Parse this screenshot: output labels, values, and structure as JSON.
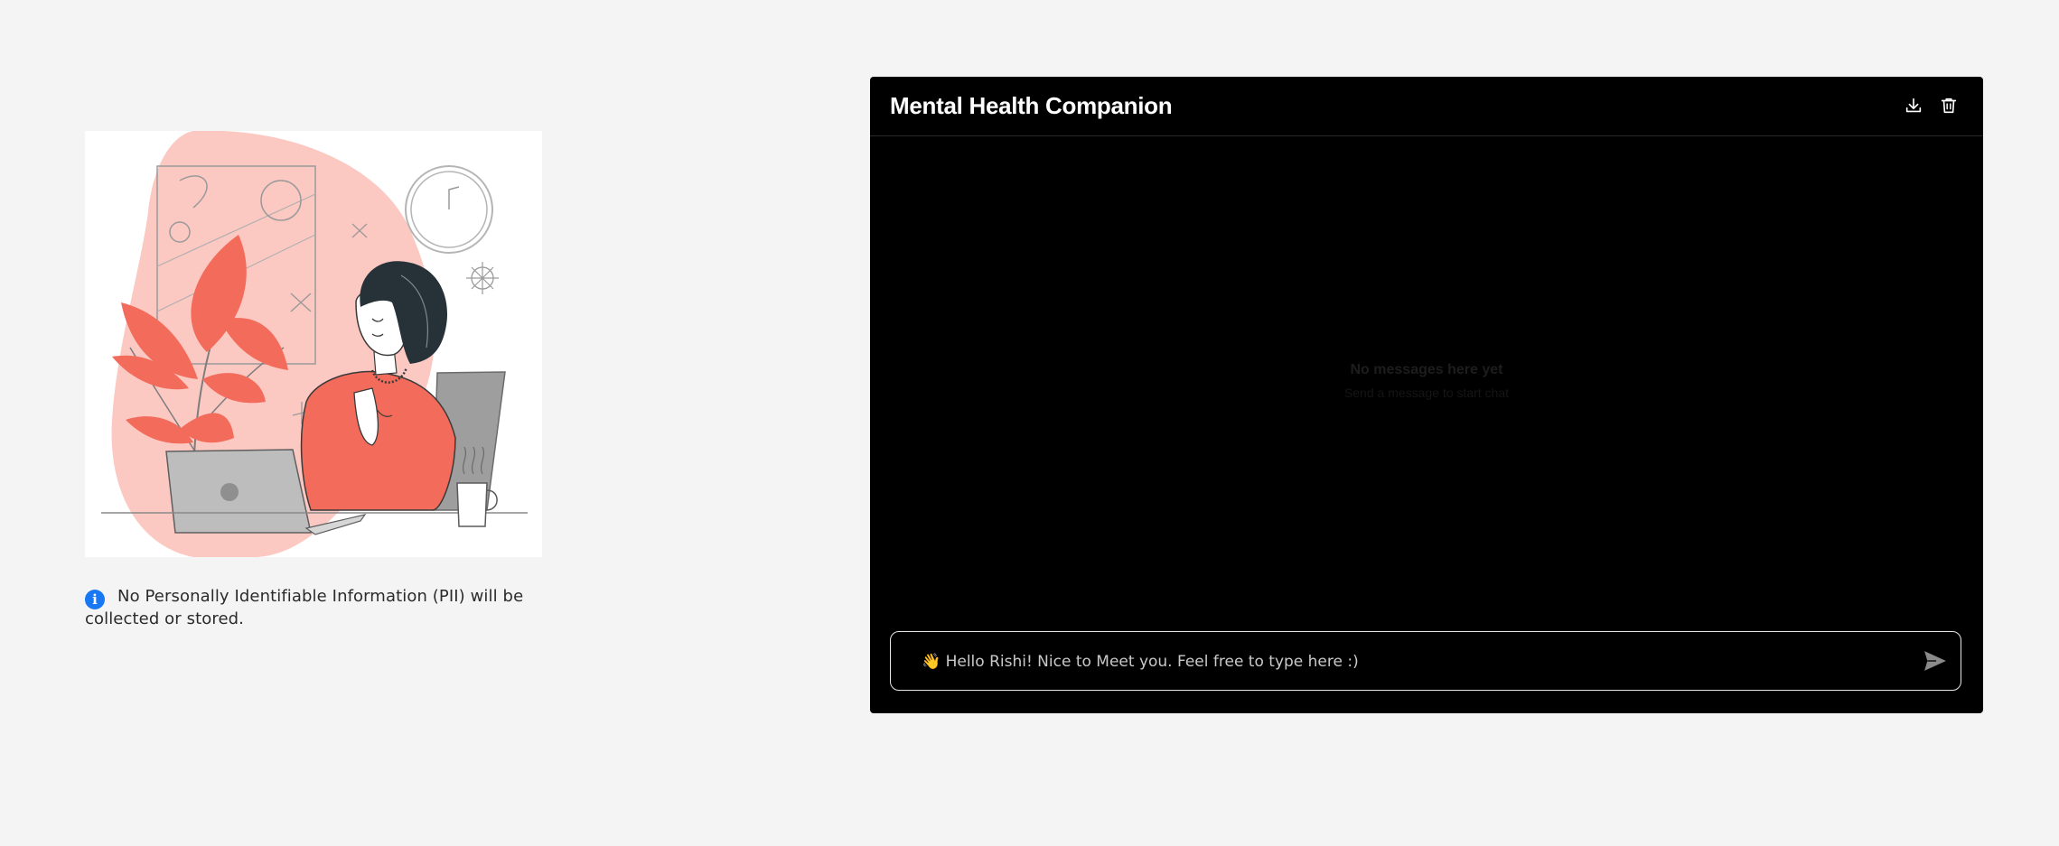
{
  "left_panel": {
    "illustration_icon": "woman-meditating-at-laptop-illustration",
    "pii_notice": {
      "icon": "info-icon",
      "icon_glyph": "i",
      "text": "No Personally Identifiable Information (PII) will be collected or stored."
    }
  },
  "chat": {
    "title": "Mental Health Companion",
    "header_actions": [
      {
        "icon": "download-icon"
      },
      {
        "icon": "trash-icon"
      }
    ],
    "empty_state": {
      "title": "No messages here yet",
      "subtitle": "Send a message to start chat"
    },
    "input": {
      "placeholder": "👋 Hello Rishi! Nice to Meet you. Feel free to type here :)",
      "value": ""
    },
    "send_icon": "send-icon"
  },
  "colors": {
    "page_background": "#f4f4f4",
    "chat_background": "#000000",
    "accent_blue": "#1877f2",
    "illustration_coral": "#f26b5b",
    "illustration_blush": "#fcc8c2"
  }
}
